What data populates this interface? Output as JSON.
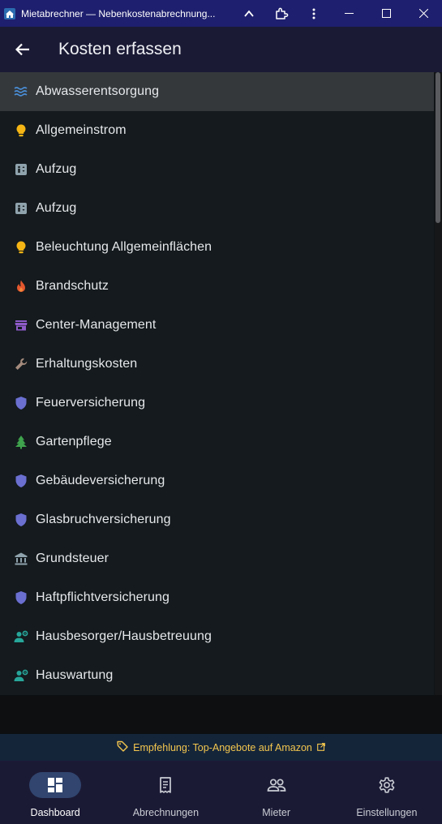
{
  "window": {
    "title": "Mietabrechner — Nebenkostenabrechnung..."
  },
  "appbar": {
    "title": "Kosten erfassen"
  },
  "colors": {
    "titlebar": "#1e1f6e",
    "appbar": "#1b1a35",
    "list_bg": "#141a1d",
    "selected": "#34383b",
    "banner_text": "#f3c64e",
    "nav_active_pill": "#31456e"
  },
  "items": [
    {
      "label": "Abwasserentsorgung",
      "icon": "waves-icon",
      "color": "#4a8fd9",
      "selected": true
    },
    {
      "label": "Allgemeinstrom",
      "icon": "lightbulb-icon",
      "color": "#f5b514"
    },
    {
      "label": "Aufzug",
      "icon": "elevator-icon",
      "color": "#8fa3ad"
    },
    {
      "label": "Aufzug",
      "icon": "elevator-icon",
      "color": "#8fa3ad"
    },
    {
      "label": "Beleuchtung Allgemeinflächen",
      "icon": "lightbulb-icon",
      "color": "#f5b514"
    },
    {
      "label": "Brandschutz",
      "icon": "fire-icon",
      "color": "#e4572e"
    },
    {
      "label": "Center-Management",
      "icon": "storefront-icon",
      "color": "#8e5bc9"
    },
    {
      "label": "Erhaltungskosten",
      "icon": "wrench-icon",
      "color": "#a48b7d"
    },
    {
      "label": "Feuerversicherung",
      "icon": "shield-icon",
      "color": "#6a6fd0"
    },
    {
      "label": "Gartenpflege",
      "icon": "tree-icon",
      "color": "#3fa34d"
    },
    {
      "label": "Gebäudeversicherung",
      "icon": "shield-icon",
      "color": "#6a6fd0"
    },
    {
      "label": "Glasbruchversicherung",
      "icon": "shield-icon",
      "color": "#6a6fd0"
    },
    {
      "label": "Grundsteuer",
      "icon": "bank-icon",
      "color": "#8fa3ad"
    },
    {
      "label": "Haftpflichtversicherung",
      "icon": "shield-icon",
      "color": "#6a6fd0"
    },
    {
      "label": "Hausbesorger/Hausbetreuung",
      "icon": "person-gear-icon",
      "color": "#27a69a"
    },
    {
      "label": "Hauswartung",
      "icon": "person-gear-icon",
      "color": "#27a69a"
    }
  ],
  "banner": {
    "text": "Empfehlung: Top-Angebote auf Amazon",
    "icon": "tag-icon"
  },
  "nav": [
    {
      "label": "Dashboard",
      "icon": "dashboard-icon",
      "active": true
    },
    {
      "label": "Abrechnungen",
      "icon": "receipt-icon"
    },
    {
      "label": "Mieter",
      "icon": "people-icon"
    },
    {
      "label": "Einstellungen",
      "icon": "gear-icon"
    }
  ]
}
